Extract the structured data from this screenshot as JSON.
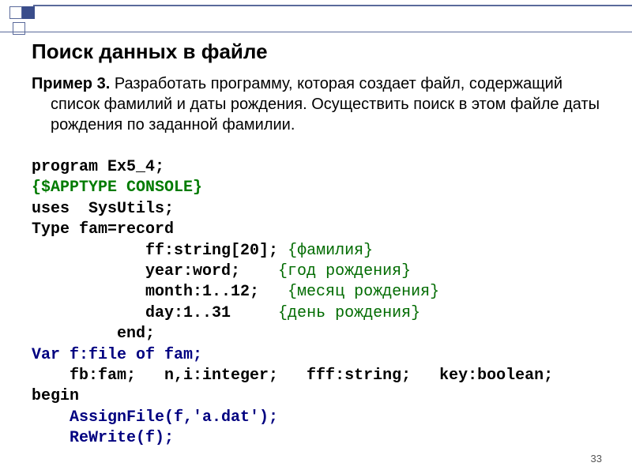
{
  "heading": "Поиск данных в файле",
  "desc_prefix": "Пример 3.",
  "desc_text": " Разработать программу, которая создает файл, содержащий список фамилий и даты рождения. Осуществить поиск в этом файле даты рождения по заданной фамилии.",
  "page_number": "33",
  "code": {
    "l1": "program Ex5_4;",
    "l2": "{$APPTYPE CONSOLE}",
    "l3": "uses  SysUtils;",
    "l4": "Type fam=record",
    "l5a": "            ff:string[20];",
    "l5c": " {фамилия}",
    "l6a": "            year:word;",
    "l6c": "    {год рождения}",
    "l7a": "            month:1..12;",
    "l7c": "   {месяц рождения}",
    "l8a": "            day:1..31",
    "l8c": "     {день рождения}",
    "l9": "         end;",
    "l10": "Var f:file of fam;",
    "l11": "    fb:fam;   n,i:integer;   fff:string;   key:boolean;",
    "l12": "begin",
    "l13": "    AssignFile(f,'a.dat');",
    "l14": "    ReWrite(f);"
  }
}
